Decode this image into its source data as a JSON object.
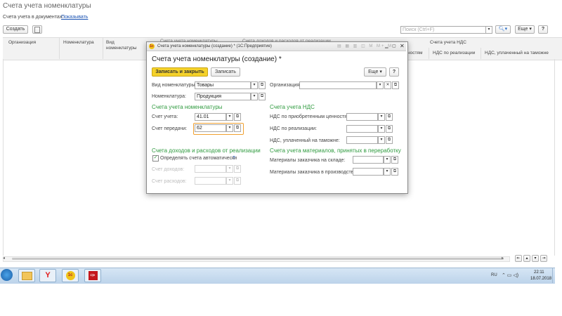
{
  "page": {
    "title": "Счета учета номенклатуры",
    "docs_label": "Счета учета в документах:",
    "docs_link": "Показывать",
    "create_label": "Создать",
    "search_placeholder": "Поиск (Ctrl+F)",
    "more_label": "Еще",
    "help_label": "?"
  },
  "table": {
    "columns": [
      "Организация",
      "Номенклатура",
      "Вид номенклатуры",
      "Счета учета НДС",
      "НДС по приобретенным ценностям",
      "НДС по реализации",
      "НДС, уплаченный на таможне"
    ],
    "partial_columns": [
      "Счета учета номенклатуры",
      "Счета доходов и расходов от реализации"
    ],
    "visible_fragments": [
      "ностям"
    ]
  },
  "dialog": {
    "window_title": "Счета учета номенклатуры (создание) * (1С:Предприятие)",
    "heading": "Счета учета номенклатуры (создание) *",
    "save_close": "Записать и закрыть",
    "save": "Записать",
    "more": "Еще",
    "help": "?",
    "kind_label": "Вид номенклатуры:",
    "kind_value": "Товары",
    "org_label": "Организация:",
    "org_value": "",
    "item_label": "Номенклатура:",
    "item_value": "Продукция",
    "accounts_section": "Счета учета номенклатуры",
    "account_label": "Счет учета:",
    "account_value": "41.01",
    "transfer_label": "Счет передачи:",
    "transfer_value": "62",
    "vat_section": "Счета учета НДС",
    "vat_acquired_label": "НДС по приобретенным ценностям:",
    "vat_sales_label": "НДС по реализации:",
    "vat_customs_label": "НДС, уплаченный на таможне:",
    "income_section": "Счета доходов и расходов от реализации",
    "auto_label": "Определять счета автоматически",
    "auto_help": "?",
    "auto_checked": true,
    "income_label": "Счет доходов:",
    "expense_label": "Счет расходов:",
    "materials_section": "Счета учета материалов, принятых в переработку",
    "mat_warehouse_label": "Материалы заказчика на складе:",
    "mat_production_label": "Материалы заказчика в производстве:"
  },
  "taskbar": {
    "lang": "RU",
    "time": "22:11",
    "date": "18.07.2018",
    "apps": [
      "windows-start",
      "file-explorer",
      "yandex-browser",
      "1c-enterprise",
      "pdf-reader"
    ]
  },
  "colors": {
    "accent_yellow": "#f5d22a",
    "section_green": "#2e9a3e",
    "taskbar": "#c9dcef",
    "focus_orange": "#f0a030"
  }
}
